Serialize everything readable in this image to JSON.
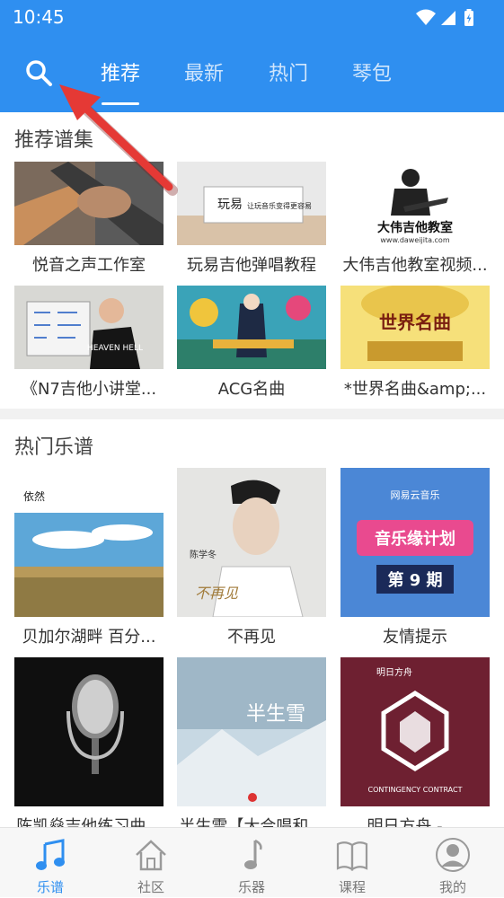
{
  "status_bar": {
    "time": "10:45"
  },
  "tabs": [
    {
      "label": "推荐",
      "active": true
    },
    {
      "label": "最新",
      "active": false
    },
    {
      "label": "热门",
      "active": false
    },
    {
      "label": "琴包",
      "active": false
    }
  ],
  "sections": {
    "recommended": {
      "title": "推荐谱集",
      "items": [
        {
          "title": "悦音之声工作室"
        },
        {
          "title": "玩易吉他弹唱教程",
          "thumb_text": "玩易",
          "thumb_sub": "让玩音乐变得更容易"
        },
        {
          "title": "大伟吉他教室视频...",
          "thumb_text": "大伟吉他教室",
          "thumb_sub": "www.daweijita.com"
        },
        {
          "title": "《N7吉他小讲堂...",
          "thumb_text": "HEAVEN HELL"
        },
        {
          "title": "ACG名曲"
        },
        {
          "title": "*世界名曲&amp;...",
          "thumb_text": "世界名曲"
        }
      ]
    },
    "hot": {
      "title": "热门乐谱",
      "items": [
        {
          "title": "贝加尔湖畔 百分...",
          "thumb_text": "依然"
        },
        {
          "title": "不再见",
          "thumb_text": "陈学冬",
          "thumb_sub": "不再见"
        },
        {
          "title": "友情提示",
          "thumb_text": "网易云音乐",
          "thumb_sub": "音乐缘计划",
          "thumb_sub2": "第 9 期"
        },
        {
          "title": "陈凯燊吉他练习曲..."
        },
        {
          "title": "半生雪【大合唱和...",
          "thumb_text": "半生雪"
        },
        {
          "title": "明日方舟 - ...",
          "thumb_text": "明日方舟",
          "thumb_sub": "CONTINGENCY CONTRACT"
        }
      ]
    }
  },
  "bottom_nav": [
    {
      "label": "乐谱",
      "icon": "music-note-icon",
      "active": true
    },
    {
      "label": "社区",
      "icon": "home-icon",
      "active": false
    },
    {
      "label": "乐器",
      "icon": "instrument-icon",
      "active": false
    },
    {
      "label": "课程",
      "icon": "book-icon",
      "active": false
    },
    {
      "label": "我的",
      "icon": "profile-icon",
      "active": false
    }
  ],
  "colors": {
    "accent": "#2f8ff0",
    "annotation_arrow": "#e53935"
  }
}
